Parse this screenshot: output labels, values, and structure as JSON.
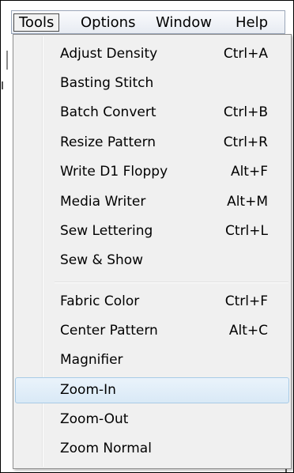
{
  "menubar": {
    "items": [
      {
        "label": "Tools"
      },
      {
        "label": "Options"
      },
      {
        "label": "Window"
      },
      {
        "label": "Help"
      }
    ]
  },
  "dropdown": {
    "items": [
      {
        "label": "Adjust Density",
        "shortcut": "Ctrl+A"
      },
      {
        "label": "Basting Stitch",
        "shortcut": ""
      },
      {
        "label": "Batch Convert",
        "shortcut": "Ctrl+B"
      },
      {
        "label": "Resize Pattern",
        "shortcut": "Ctrl+R"
      },
      {
        "label": "Write D1 Floppy",
        "shortcut": "Alt+F"
      },
      {
        "label": "Media Writer",
        "shortcut": "Alt+M"
      },
      {
        "label": "Sew Lettering",
        "shortcut": "Ctrl+L"
      },
      {
        "label": "Sew & Show",
        "shortcut": ""
      },
      {
        "label": "Fabric Color",
        "shortcut": "Ctrl+F"
      },
      {
        "label": "Center Pattern",
        "shortcut": "Alt+C"
      },
      {
        "label": "Magnifier",
        "shortcut": ""
      },
      {
        "label": "Zoom-In",
        "shortcut": ""
      },
      {
        "label": "Zoom-Out",
        "shortcut": ""
      },
      {
        "label": "Zoom Normal",
        "shortcut": ""
      }
    ]
  },
  "colors": {
    "highlight_bg": "#d9e9f6",
    "highlight_border": "#a8cbe6",
    "menu_bg": "#f0f0f0"
  }
}
